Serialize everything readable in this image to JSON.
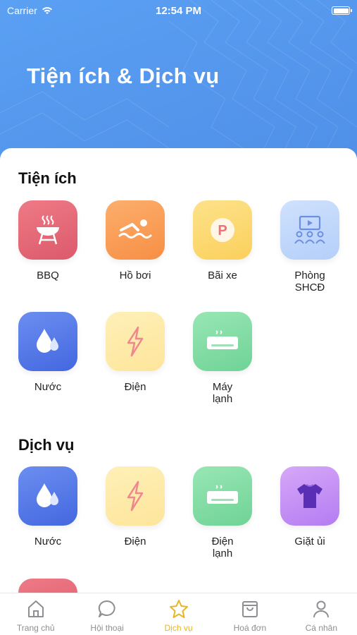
{
  "status_bar": {
    "carrier": "Carrier",
    "time": "12:54 PM"
  },
  "header": {
    "title": "Tiện ích & Dịch vụ"
  },
  "sections": {
    "utilities": {
      "title": "Tiện ích",
      "items": [
        {
          "label": "BBQ",
          "icon": "grill-icon",
          "color": "#e0606f"
        },
        {
          "label": "Hồ bơi",
          "icon": "swimmer-icon",
          "color": "#f9974f"
        },
        {
          "label": "Bãi xe",
          "icon": "parking-icon",
          "color": "#fcd766"
        },
        {
          "label": "Phòng\nSHCĐ",
          "icon": "community-hall-icon",
          "color": "#bcd5fa"
        },
        {
          "label": "Nước",
          "icon": "water-drop-icon",
          "color": "#4d6fe4"
        },
        {
          "label": "Điện",
          "icon": "lightning-icon",
          "color": "#fde9a5"
        },
        {
          "label": "Máy\nlạnh",
          "icon": "air-conditioner-icon",
          "color": "#7bd8a0"
        }
      ]
    },
    "services": {
      "title": "Dịch vụ",
      "items": [
        {
          "label": "Nước",
          "icon": "water-drop-icon",
          "color": "#4d6fe4"
        },
        {
          "label": "Điện",
          "icon": "lightning-icon",
          "color": "#fde9a5"
        },
        {
          "label": "Điện\nlạnh",
          "icon": "air-conditioner-icon",
          "color": "#7bd8a0"
        },
        {
          "label": "Giặt ủi",
          "icon": "tshirt-icon",
          "color": "#bf89f4"
        }
      ]
    }
  },
  "tabbar": {
    "items": [
      {
        "label": "Trang chủ",
        "icon": "home-icon",
        "active": false
      },
      {
        "label": "Hội thoại",
        "icon": "chat-icon",
        "active": false
      },
      {
        "label": "Dịch vụ",
        "icon": "star-icon",
        "active": true
      },
      {
        "label": "Hoá đơn",
        "icon": "shopping-bag-icon",
        "active": false
      },
      {
        "label": "Cá nhân",
        "icon": "person-icon",
        "active": false
      }
    ],
    "active_color": "#e7b623",
    "inactive_color": "#8e8e93"
  }
}
